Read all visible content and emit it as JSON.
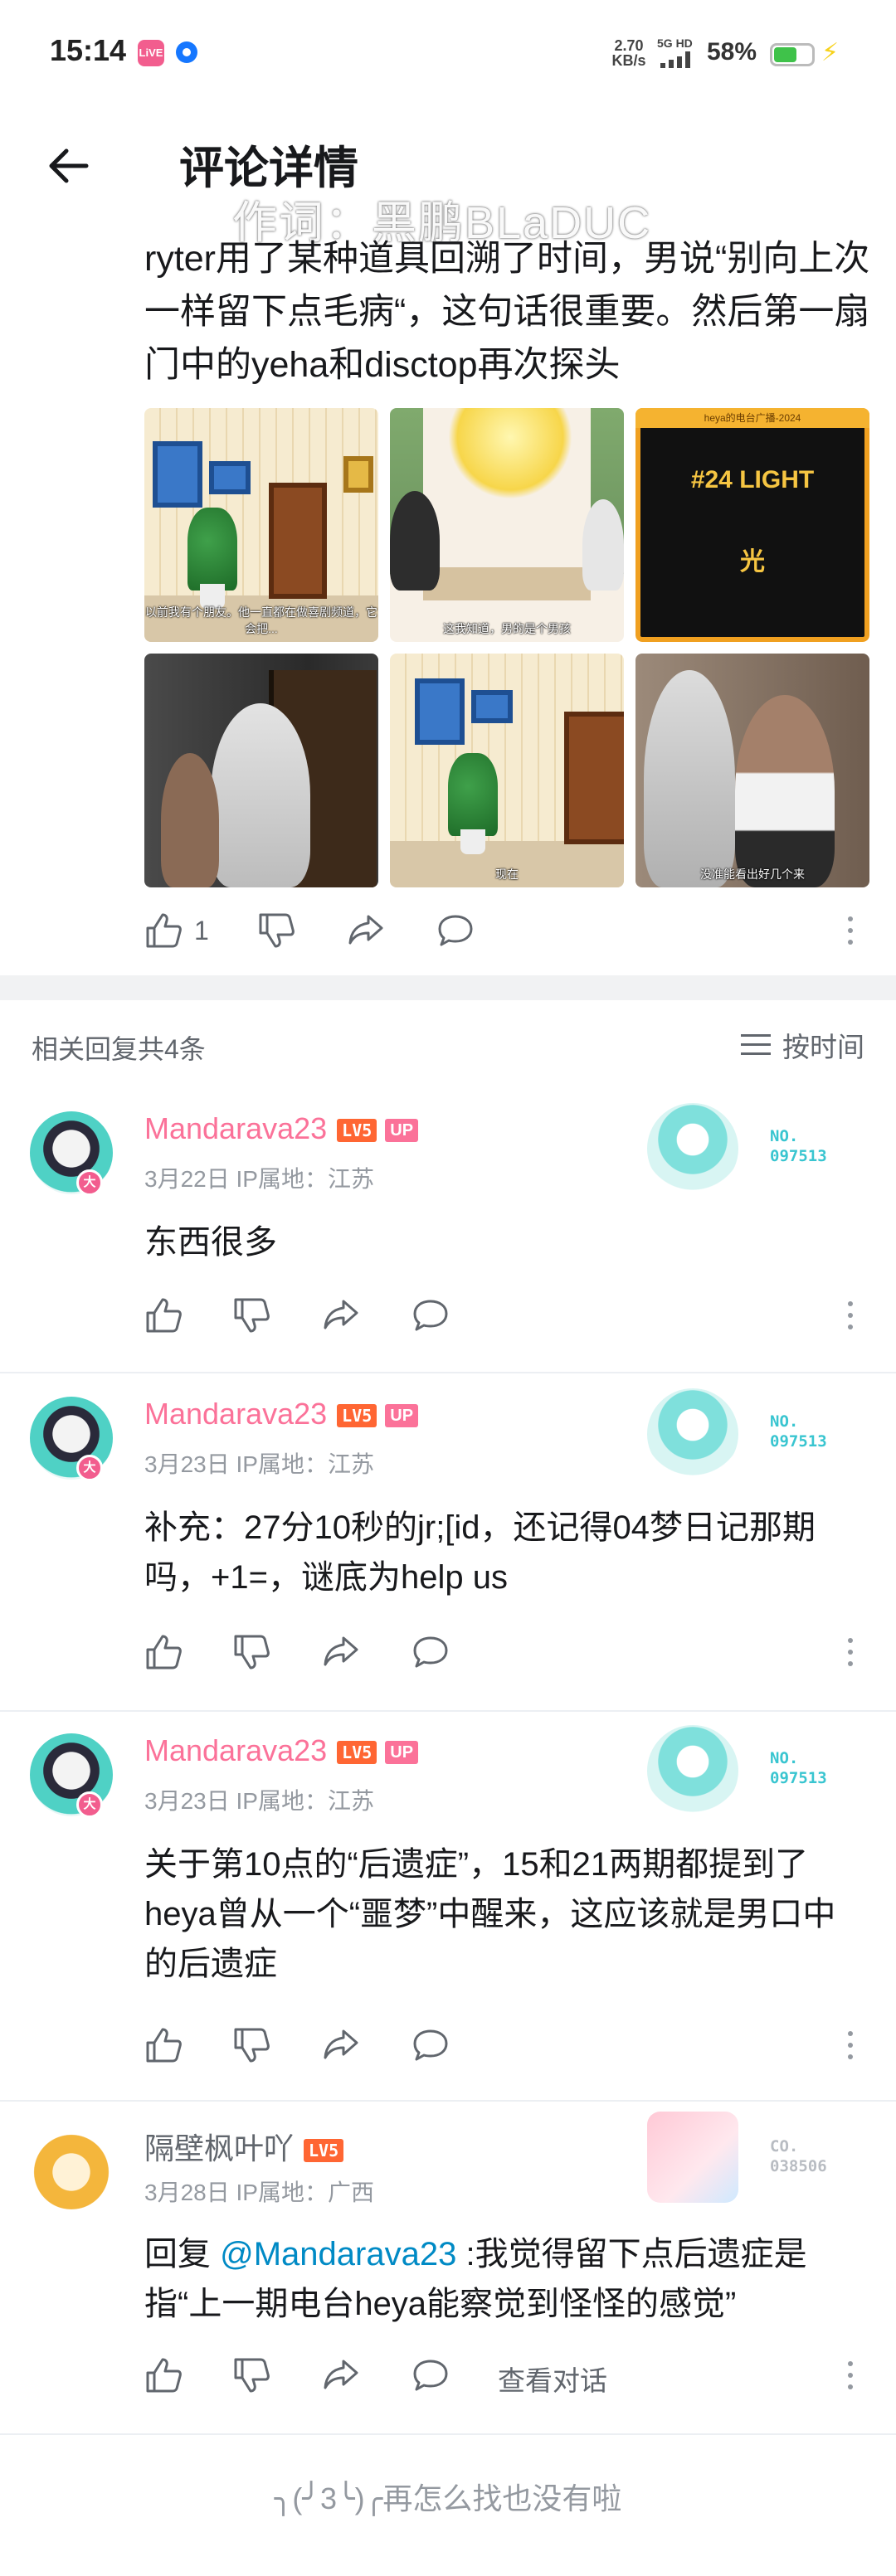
{
  "status_bar": {
    "time": "15:14",
    "app_badge": "LiVE",
    "net_speed_value": "2.70",
    "net_speed_unit": "KB/s",
    "net_type": "5G HD",
    "battery": "58%",
    "battery_level": 0.58
  },
  "header": {
    "title": "评论详情",
    "watermark": "作词：黑鹏BLaDUC"
  },
  "main_comment": {
    "text": "ryter用了某种道具回溯了时间，男说“别向上次一样留下点毛病“，这句话很重要。然后第一扇门中的yeha和disctop再次探头",
    "images": [
      {
        "subtitle": "以前我有个朋友。他一直都在做喜剧频道，它会把..."
      },
      {
        "subtitle": "这我知道，男的是个男孩"
      },
      {
        "header": "heya的电台广播-2024",
        "number": "#24 LIGHT",
        "char": "光"
      },
      {
        "subtitle": ""
      },
      {
        "subtitle": "现在"
      },
      {
        "subtitle": "没准能看出好几个来"
      }
    ],
    "like_count": "1"
  },
  "replies_header": {
    "count_text": "相关回复共4条",
    "sort_label": "按时间"
  },
  "replies": [
    {
      "username": "Mandarava23",
      "level": "LV5",
      "up": "UP",
      "avatar_badge": "大",
      "meta": "3月22日 IP属地：江苏",
      "text": "东西很多",
      "fan_no": "NO.",
      "fan_id": "097513"
    },
    {
      "username": "Mandarava23",
      "level": "LV5",
      "up": "UP",
      "avatar_badge": "大",
      "meta": "3月23日 IP属地：江苏",
      "text": "补充：27分10秒的jr;[id，还记得04梦日记那期吗，+1=，谜底为help us",
      "fan_no": "NO.",
      "fan_id": "097513"
    },
    {
      "username": "Mandarava23",
      "level": "LV5",
      "up": "UP",
      "avatar_badge": "大",
      "meta": "3月23日 IP属地：江苏",
      "text": "关于第10点的“后遗症”，15和21两期都提到了heya曾从一个“噩梦”中醒来，这应该就是男口中的后遗症",
      "fan_no": "NO.",
      "fan_id": "097513"
    },
    {
      "username": "隔壁枫叶吖",
      "level": "LV5",
      "meta": "3月28日 IP属地：广西",
      "reply_prefix": "回复 ",
      "mention": "@Mandarava23",
      "text": " :我觉得留下点后遗症是指“上一期电台heya能察觉到怪怪的感觉”",
      "fan_no": "CO.",
      "fan_id": "038506",
      "view_conversation": "查看对话"
    }
  ],
  "footer": {
    "end_text": "╮(╯3╰)╭再怎么找也没有啦"
  },
  "colors": {
    "accent_pink": "#fb7299",
    "level_orange": "#ff6633",
    "link_blue": "#008ac5",
    "fan_teal": "#39c5d0"
  }
}
